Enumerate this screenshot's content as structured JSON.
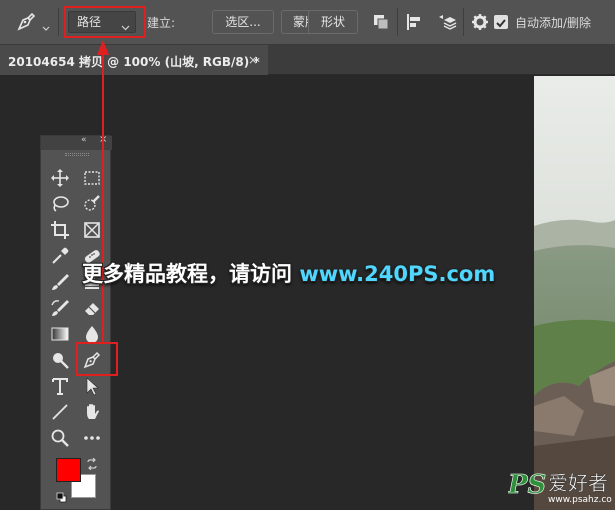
{
  "options_bar": {
    "tool_icon": "pen-tool-icon",
    "mode_value": "路径",
    "build_label": "建立:",
    "selection_button": "选区...",
    "mask_button": "蒙版",
    "shape_button": "形状",
    "path_ops_icon": "path-operations-icon",
    "path_align_icon": "path-alignment-icon",
    "path_arrange_icon": "path-arrangement-icon",
    "settings_icon": "gear-icon",
    "auto_add_delete_label": "自动添加/删除",
    "auto_add_delete_checked": true
  },
  "document_tab": {
    "title": "20104654 拷贝 @ 100% (山坡, RGB/8) *",
    "close": "×"
  },
  "toolbar": {
    "collapse_glyph": "«",
    "close_glyph": "×",
    "tools": [
      "move-icon",
      "marquee-icon",
      "lasso-icon",
      "quick-selection-icon",
      "crop-icon",
      "frame-icon",
      "eyedropper-icon",
      "spot-healing-icon",
      "brush-icon",
      "clone-stamp-icon",
      "history-brush-icon",
      "eraser-icon",
      "gradient-icon",
      "blur-icon",
      "dodge-icon",
      "pen-tool-icon",
      "type-icon",
      "path-selection-icon",
      "line-icon",
      "hand-icon",
      "zoom-icon",
      "more-icon"
    ],
    "foreground_color": "#ff0000",
    "background_color": "#ffffff"
  },
  "watermark": {
    "text": "更多精品教程，请访问 ",
    "url": "www.240PS.com"
  },
  "corner_logo": {
    "brand": "PS",
    "name": "爱好者",
    "url": "www.psahz.com"
  },
  "colors": {
    "annotation": "#e02020",
    "panel": "#535353",
    "canvas": "#282828",
    "watermark_url": "#4fd7ff"
  }
}
